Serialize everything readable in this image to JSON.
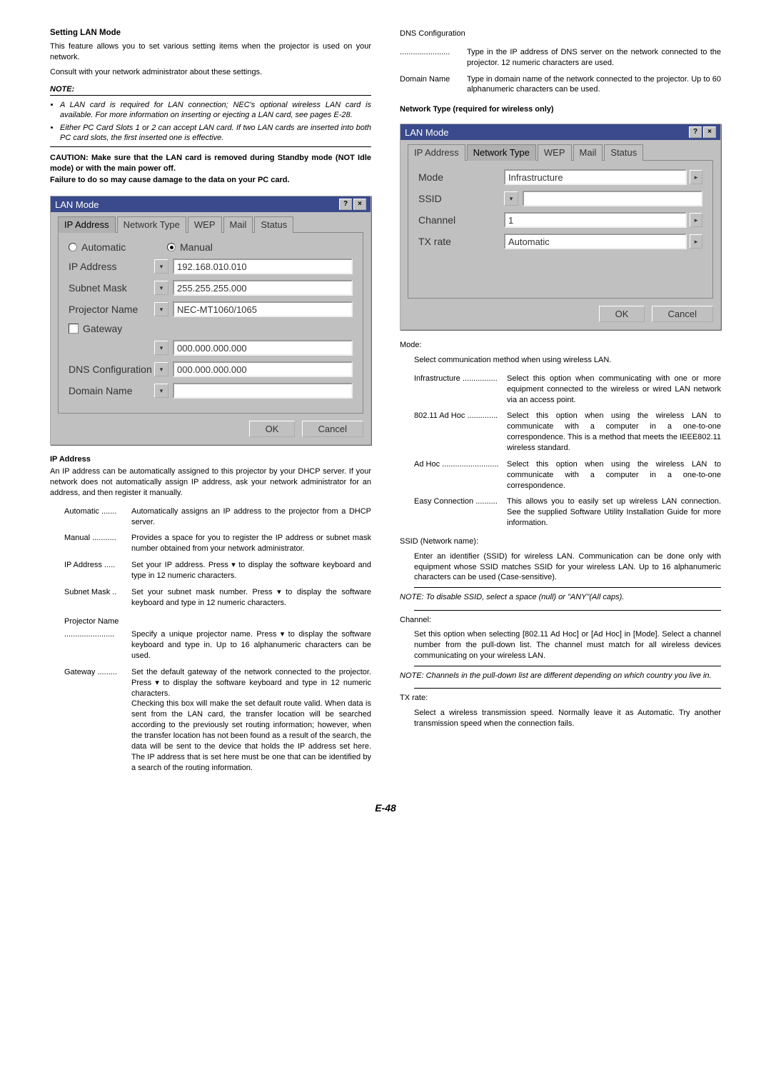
{
  "page_number": "E-48",
  "left": {
    "title": "Setting LAN Mode",
    "intro1": "This feature allows you to set various setting items when the projector is used on your network.",
    "intro2": "Consult with your network administrator about these settings.",
    "note_label": "NOTE:",
    "notes": [
      "A LAN card is required for LAN connection; NEC's optional wireless LAN card is available. For more information on inserting or ejecting a LAN card, see pages E-28.",
      "Either PC Card Slots 1 or 2 can accept LAN card. If two LAN cards are inserted into both PC card slots, the first inserted one is effective."
    ],
    "caution1": "CAUTION: Make sure that the LAN card is removed during Standby mode (NOT Idle mode) or with the main power off.",
    "caution2": "Failure to do so may cause damage to the data on your PC card.",
    "dialog1": {
      "title": "LAN Mode",
      "tabs": [
        "IP Address",
        "Network Type",
        "WEP",
        "Mail",
        "Status"
      ],
      "active_tab": 0,
      "radio_auto": "Automatic",
      "radio_manual": "Manual",
      "rows": [
        {
          "label": "IP Address",
          "value": "192.168.010.010"
        },
        {
          "label": "Subnet Mask",
          "value": "255.255.255.000"
        },
        {
          "label": "Projector Name",
          "value": "NEC-MT1060/1065"
        }
      ],
      "gateway_label": "Gateway",
      "gateway_value": "000.000.000.000",
      "dns_label": "DNS Configuration",
      "dns_value": "000.000.000.000",
      "domain_label": "Domain Name",
      "domain_value": "",
      "ok": "OK",
      "cancel": "Cancel"
    },
    "ip_heading": "IP Address",
    "ip_para": "An IP address can be automatically assigned to this projector by your DHCP server. If your network does not automatically assign IP address, ask your network administrator for an address, and then register it manually.",
    "defs": [
      {
        "t": "Automatic .......",
        "d": "Automatically assigns an IP address to the projector from a DHCP server."
      },
      {
        "t": "Manual ...........",
        "d": "Provides a space for you to register the IP address or subnet mask number obtained from your network administrator."
      },
      {
        "t": "IP Address .....",
        "d": "Set your IP address. Press ▾ to display the software keyboard and type in 12 numeric characters."
      },
      {
        "t": "Subnet Mask ..",
        "d": "Set your subnet mask number. Press ▾ to display the software keyboard and type in 12 numeric characters."
      }
    ],
    "proj_name_label": "Projector Name",
    "proj_name_desc": "Specify a unique projector name. Press ▾ to display the software keyboard and type in. Up to 16 alphanumeric characters can be used.",
    "gateway_label": "Gateway .........",
    "gateway_desc": "Set the default gateway of the network connected to the projector. Press ▾ to display the software keyboard and type in 12 numeric characters.\nChecking this box will make the set default route valid. When data is sent from the LAN card, the transfer location will be searched according to the previously set routing information; however, when the transfer location has not been found as a result of the search, the data will be sent to the device that holds the IP address set here. The IP address that is set here must be one that can be identified by a search of the routing information."
  },
  "right": {
    "dns_label": "DNS Configuration",
    "dns_desc": "Type in the IP address of DNS server on the network connected to the projector. 12 numeric characters are used.",
    "domain_label": "Domain Name",
    "domain_desc": "Type in domain name of the network connected to the projector. Up to 60 alphanumeric characters can be used.",
    "nt_heading": "Network Type (required for wireless only)",
    "dialog2": {
      "title": "LAN Mode",
      "tabs": [
        "IP Address",
        "Network Type",
        "WEP",
        "Mail",
        "Status"
      ],
      "active_tab": 1,
      "rows": [
        {
          "label": "Mode",
          "value": "Infrastructure",
          "dd": true
        },
        {
          "label": "SSID",
          "value": "",
          "dd": false,
          "kbd": true
        },
        {
          "label": "Channel",
          "value": "1",
          "dd": true
        },
        {
          "label": "TX rate",
          "value": "Automatic",
          "dd": true
        }
      ],
      "ok": "OK",
      "cancel": "Cancel"
    },
    "mode_heading": "Mode:",
    "mode_intro": "Select communication method when using wireless LAN.",
    "mode_defs": [
      {
        "t": "Infrastructure ................",
        "d": "Select this option when communicating with one or more equipment connected to the wireless or wired LAN network via an access point."
      },
      {
        "t": "802.11 Ad Hoc ..............",
        "d": "Select this option when using the wireless LAN to communicate with a computer in a one-to-one correspondence. This is a method that meets the IEEE802.11 wireless standard."
      },
      {
        "t": "Ad Hoc ..........................",
        "d": "Select this option when using the wireless LAN to communicate with a computer in a one-to-one correspondence."
      },
      {
        "t": "Easy Connection ..........",
        "d": "This allows you to easily set up wireless LAN connection. See the supplied Software Utility Installation Guide for more information."
      }
    ],
    "ssid_heading": "SSID (Network name):",
    "ssid_para": "Enter an identifier (SSID) for wireless LAN. Communication can be done only with equipment whose SSID matches SSID for your wireless LAN. Up to 16 alphanumeric characters can be used (Case-sensitive).",
    "ssid_note": "NOTE: To disable SSID, select a space (null) or \"ANY\"(All caps).",
    "channel_heading": "Channel:",
    "channel_para": "Set this option when selecting [802.11 Ad Hoc] or [Ad Hoc] in [Mode]. Select a channel number from the pull-down list. The channel must match for all wireless devices communicating on your wireless LAN.",
    "channel_note": "NOTE: Channels in the pull-down list are different depending on which country you live in.",
    "tx_heading": "TX rate:",
    "tx_para": "Select a wireless transmission speed. Normally leave it as Automatic. Try another transmission speed when the connection fails."
  }
}
